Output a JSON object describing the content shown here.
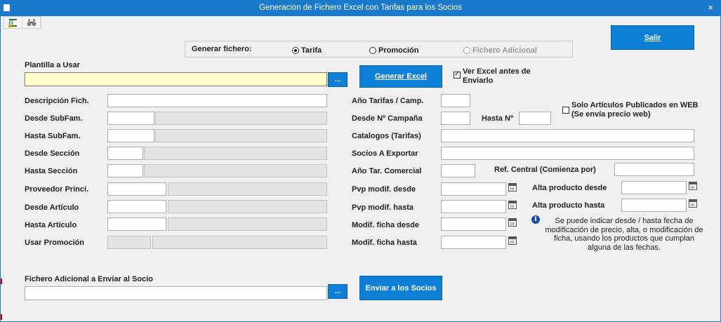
{
  "window": {
    "title": "Generación de Fichero Excel con Tarifas para los Socios",
    "close": "×"
  },
  "toolbar": {
    "icon1": "excel-export-icon",
    "icon2": "binoculars-icon"
  },
  "buttons": {
    "salir": "Salir",
    "generar_excel": "Generar Excel",
    "enviar": "Enviar a los Socios",
    "browse": "..."
  },
  "generar": {
    "label": "Generar fichero:",
    "options": [
      "Tarifa",
      "Promoción",
      "Fichero Adicional"
    ],
    "selected": "Tarifa"
  },
  "plantilla": {
    "label": "Plantilla a Usar",
    "value": ""
  },
  "ver_excel": {
    "label_line1": "Ver Excel antes de",
    "label_line2": "Enviarlo",
    "checked": true
  },
  "left_fields": [
    "Descripción Fich.",
    "Desde SubFam.",
    "Hasta SubFam.",
    "Desde Sección",
    "Hasta Sección",
    "Proveedor Princi.",
    "Desde Artículo",
    "Hasta Artículo",
    "Usar Promoción"
  ],
  "right_fields": {
    "ano_tarifas": "Año Tarifas / Camp.",
    "desde_campana": "Desde Nº Campaña",
    "hasta_n": "Hasta Nº",
    "catalogos": "Catalogos (Tarifas)",
    "socios": "Socios A Exportar",
    "ano_tar_comercial": "Año Tar. Comercial",
    "ref_central": "Ref. Central (Comienza por)",
    "pvp_desde": "Pvp modif. desde",
    "pvp_hasta": "Pvp modif. hasta",
    "ficha_desde": "Modif. ficha desde",
    "ficha_hasta": "Modif. ficha hasta",
    "alta_desde": "Alta producto desde",
    "alta_hasta": "Alta producto hasta"
  },
  "solo_web": {
    "line1": "Solo Artículos Publicados en WEB",
    "line2": "(Se envía precio web)",
    "checked": false
  },
  "note": "Se puede indicar desde / hasta fecha de modificación de precio, alta, o modificación de ficha, usando los productos que cumplan alguna de las fechas.",
  "fichero_adicional": {
    "label": "Fichero Adicional a Enviar al Socio",
    "value": ""
  },
  "colors": {
    "titlebar": "#1979ca",
    "button": "#0e7fd7",
    "highlight_field": "#ffffcc"
  }
}
